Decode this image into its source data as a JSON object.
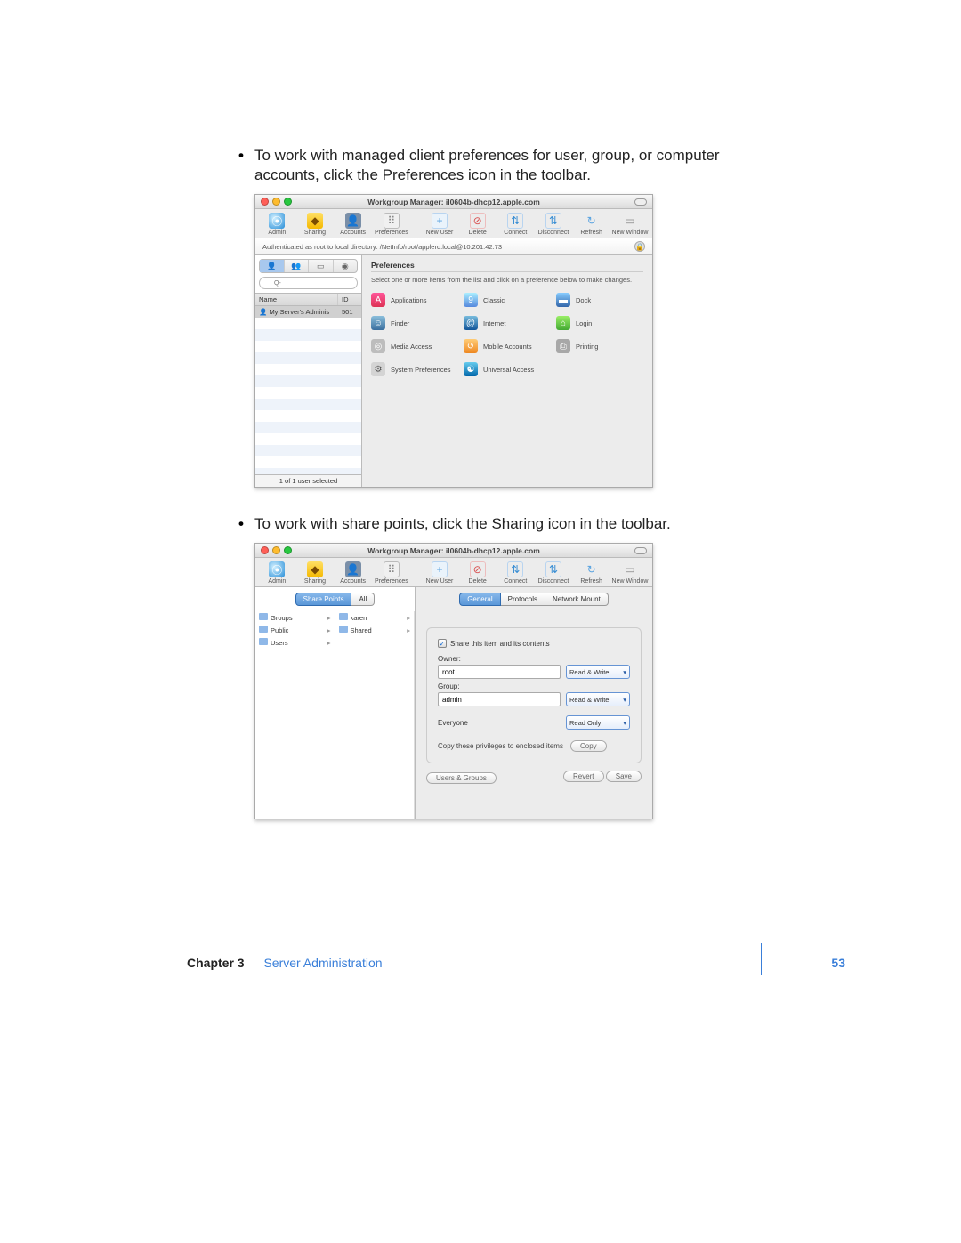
{
  "page": {
    "chapter_label": "Chapter 3",
    "chapter_title": "Server Administration",
    "page_number": "53"
  },
  "bullets": {
    "b1": "To work with managed client preferences for user, group, or computer accounts, click the Preferences icon in the toolbar.",
    "b2": "To work with share points, click the Sharing icon in the toolbar."
  },
  "app": {
    "window_title": "Workgroup Manager: il0604b-dhcp12.apple.com",
    "auth_text": "Authenticated as root to local directory: /NetInfo/root/applerd.local@10.201.42.73",
    "toolbar": {
      "admin": "Admin",
      "sharing": "Sharing",
      "accounts": "Accounts",
      "preferences": "Preferences",
      "new_user": "New User",
      "delete": "Delete",
      "connect": "Connect",
      "disconnect": "Disconnect",
      "refresh": "Refresh",
      "new_window": "New Window"
    }
  },
  "s1": {
    "search_placeholder": "Q-",
    "col_name": "Name",
    "col_id": "ID",
    "row_user": "My Server's Adminis",
    "row_id": "501",
    "status": "1 of 1 user selected",
    "right_title": "Preferences",
    "right_sub": "Select one or more items from the list and click on a preference below to make changes.",
    "prefs": {
      "applications": "Applications",
      "classic": "Classic",
      "dock": "Dock",
      "finder": "Finder",
      "internet": "Internet",
      "login": "Login",
      "media": "Media Access",
      "mobile": "Mobile Accounts",
      "printing": "Printing",
      "sysprefs": "System Preferences",
      "ua": "Universal Access"
    }
  },
  "s2": {
    "tab_sharepoints": "Share Points",
    "tab_all": "All",
    "folders_a": {
      "groups": "Groups",
      "public": "Public",
      "users": "Users"
    },
    "folders_b": {
      "karen": "karen",
      "shared": "Shared"
    },
    "tab_general": "General",
    "tab_protocols": "Protocols",
    "tab_netmount": "Network Mount",
    "share_check": "Share this item and its contents",
    "owner_label": "Owner:",
    "owner_value": "root",
    "group_label": "Group:",
    "group_value": "admin",
    "everyone_label": "Everyone",
    "perm_rw": "Read & Write",
    "perm_ro": "Read Only",
    "copy_label": "Copy these privileges to enclosed items",
    "copy_btn": "Copy",
    "users_groups": "Users & Groups",
    "revert": "Revert",
    "save": "Save"
  }
}
